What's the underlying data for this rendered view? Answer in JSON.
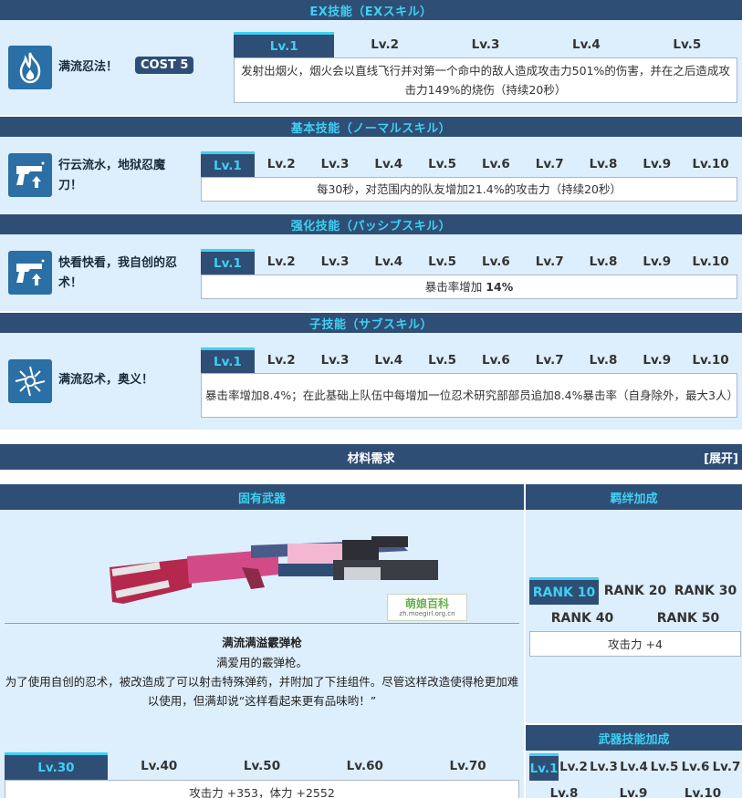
{
  "ex": {
    "header": "EX技能（EXスキル）",
    "name": "满流忍法！",
    "cost": "COST 5",
    "levels": [
      "Lv.1",
      "Lv.2",
      "Lv.3",
      "Lv.4",
      "Lv.5"
    ],
    "desc": "发射出烟火，烟火会以直线飞行并对第一个命中的敌人造成攻击力501%的伤害，并在之后造成攻击力149%的烧伤（持续20秒）",
    "icon": "flame-icon"
  },
  "normal": {
    "header": "基本技能（ノーマルスキル）",
    "name": "行云流水，地狱忍魔刀！",
    "levels": [
      "Lv.1",
      "Lv.2",
      "Lv.3",
      "Lv.4",
      "Lv.5",
      "Lv.6",
      "Lv.7",
      "Lv.8",
      "Lv.9",
      "Lv.10"
    ],
    "desc": "每30秒，对范围内的队友增加21.4%的攻击力（持续20秒）",
    "icon": "pistol-buff-icon"
  },
  "passive": {
    "header": "强化技能（パッシブスキル）",
    "name": "快看快看，我自创的忍术！",
    "levels": [
      "Lv.1",
      "Lv.2",
      "Lv.3",
      "Lv.4",
      "Lv.5",
      "Lv.6",
      "Lv.7",
      "Lv.8",
      "Lv.9",
      "Lv.10"
    ],
    "desc_prefix": "暴击率增加 ",
    "desc_value": "14%",
    "icon": "pistol-buff-icon"
  },
  "sub": {
    "header": "子技能（サブスキル）",
    "name": "满流忍术，奥义！",
    "levels": [
      "Lv.1",
      "Lv.2",
      "Lv.3",
      "Lv.4",
      "Lv.5",
      "Lv.6",
      "Lv.7",
      "Lv.8",
      "Lv.9",
      "Lv.10"
    ],
    "desc": "暴击率增加8.4%；在此基础上队伍中每增加一位忍术研究部部员追加8.4%暴击率（自身除外，最大3人）",
    "icon": "shuriken-icon"
  },
  "materials": {
    "title": "材料需求",
    "expand": "[展开]"
  },
  "weapon": {
    "header": "固有武器",
    "name": "满流满溢霰弹枪",
    "subtitle": "满爱用的霰弹枪。",
    "desc": "为了使用自创的忍术，被改造成了可以射击特殊弹药，并附加了下挂组件。尽管这样改造使得枪更加难以使用，但满却说“这样看起来更有品味哟！”",
    "watermark_text": "萌娘百科",
    "watermark_url": "zh.moegirl.org.cn",
    "levels": [
      "Lv.30",
      "Lv.40",
      "Lv.50",
      "Lv.60",
      "Lv.70"
    ],
    "stat": "攻击力 +353，体力 +2552"
  },
  "bond": {
    "header": "羁绊加成",
    "ranks": [
      "RANK 10",
      "RANK 20",
      "RANK 30",
      "RANK 40",
      "RANK 50"
    ],
    "stat": "攻击力 +4"
  },
  "weapon_skill": {
    "header": "武器技能加成",
    "levels": [
      "Lv.1",
      "Lv.2",
      "Lv.3",
      "Lv.4",
      "Lv.5",
      "Lv.6",
      "Lv.7",
      "Lv.8",
      "Lv.9",
      "Lv.10"
    ]
  },
  "colors": {
    "header_bg": "#2f4e75",
    "accent": "#3fd0f2",
    "panel_bg": "#ddeefc"
  }
}
